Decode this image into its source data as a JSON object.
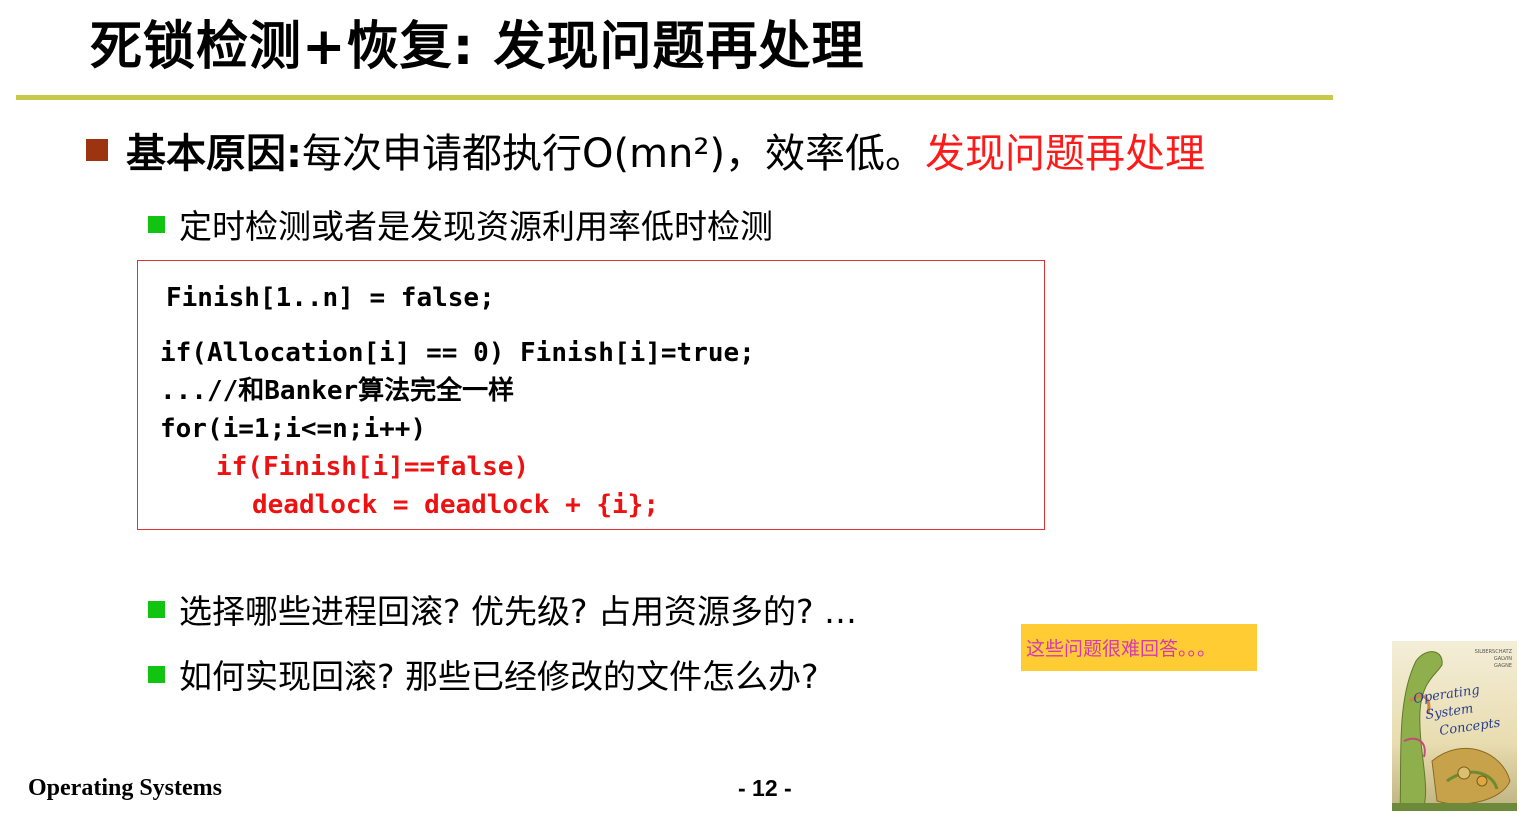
{
  "slide": {
    "title": "死锁检测+恢复: 发现问题再处理",
    "main_bullet": {
      "prefix": "基本原因: ",
      "text": "每次申请都执行O(mn²)，效率低。",
      "highlight": "发现问题再处理"
    },
    "sub_bullets": [
      "定时检测或者是发现资源利用率低时检测",
      "选择哪些进程回滚? 优先级? 占用资源多的? …",
      "如何实现回滚? 那些已经修改的文件怎么办?"
    ],
    "code": {
      "lines": [
        "Finish[1..n] = false;",
        "if(Allocation[i] == 0) Finish[i]=true;",
        "...//和Banker算法完全一样",
        "for(i=1;i<=n;i++)",
        "if(Finish[i]==false)",
        "deadlock = deadlock + {i};"
      ]
    },
    "note": "这些问题很难回答。。。",
    "footer": {
      "course": "Operating Systems",
      "page": "- 12 -"
    },
    "book_cover": {
      "authors": [
        "SILBERSCHATZ",
        "GALVIN",
        "GAGNE"
      ],
      "title_lines": [
        "Operating",
        "System",
        "Concepts"
      ]
    },
    "colors": {
      "title_rule": "#c8c84a",
      "main_bullet_square": "#9c3311",
      "sub_bullet_square": "#11c411",
      "highlight_red": "#ff1a1a",
      "code_border": "#e03232",
      "note_background": "#ffcc33",
      "note_text": "#d43ab3"
    }
  }
}
